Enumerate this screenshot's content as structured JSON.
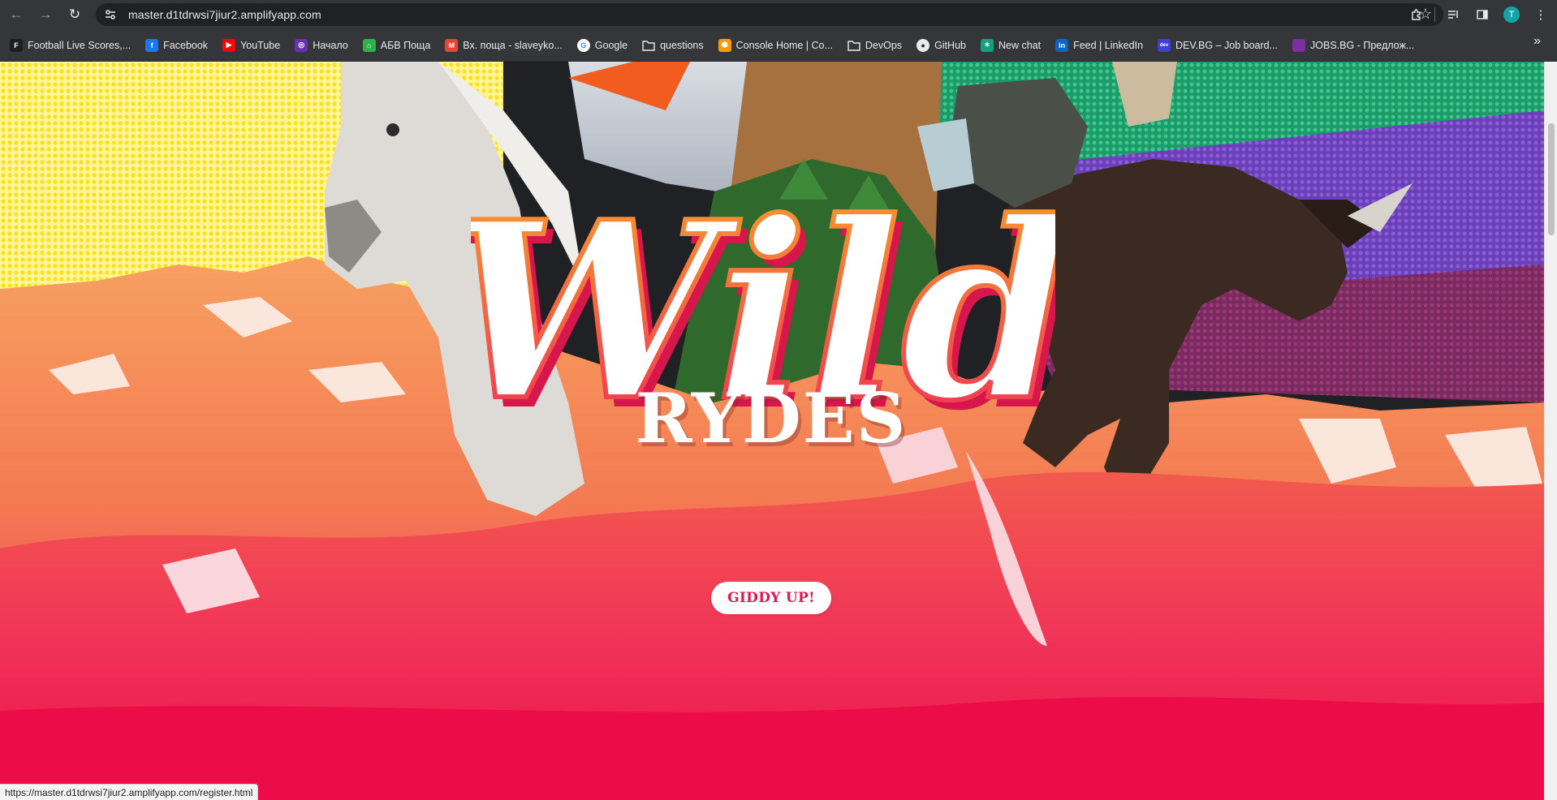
{
  "browser": {
    "url": "master.d1tdrwsi7jiur2.amplifyapp.com",
    "avatar_initial": "T",
    "bookmarks": [
      {
        "label": "Football Live Scores,...",
        "icon": "flashscore-icon",
        "color": "#1e1e1e"
      },
      {
        "label": "Facebook",
        "icon": "facebook-icon",
        "color": "#1877f2"
      },
      {
        "label": "YouTube",
        "icon": "youtube-icon",
        "color": "#ff0000"
      },
      {
        "label": "Начало",
        "icon": "start-icon",
        "color": "#6b2fb3"
      },
      {
        "label": "АБВ Поща",
        "icon": "abv-icon",
        "color": "#2bb34a"
      },
      {
        "label": "Вх. поща - slaveyko...",
        "icon": "gmail-icon",
        "color": "#ea4335"
      },
      {
        "label": "Google",
        "icon": "google-icon",
        "color": "#ffffff"
      },
      {
        "label": "questions",
        "icon": "folder-icon",
        "color": "transparent"
      },
      {
        "label": "Console Home | Co...",
        "icon": "aws-icon",
        "color": "#ff9900"
      },
      {
        "label": "DevOps",
        "icon": "folder-icon",
        "color": "transparent"
      },
      {
        "label": "GitHub",
        "icon": "github-icon",
        "color": "#24292f"
      },
      {
        "label": "New chat",
        "icon": "chatgpt-icon",
        "color": "#10a37f"
      },
      {
        "label": "Feed | LinkedIn",
        "icon": "linkedin-icon",
        "color": "#0a66c2"
      },
      {
        "label": "DEV.BG – Job board...",
        "icon": "devbg-icon",
        "color": "#3d3fd8"
      },
      {
        "label": "JOBS.BG - Предлож...",
        "icon": "jobsbg-icon",
        "color": "#7b2fa0"
      }
    ],
    "status_url": "https://master.d1tdrwsi7jiur2.amplifyapp.com/register.html"
  },
  "hero": {
    "title_script": "Wild",
    "title_block": "RYDES",
    "cta_label": "GIDDY UP!"
  },
  "colors": {
    "accent": "#e2154f",
    "brand_orange": "#f7941d",
    "brand_pink": "#ee2a5a"
  }
}
